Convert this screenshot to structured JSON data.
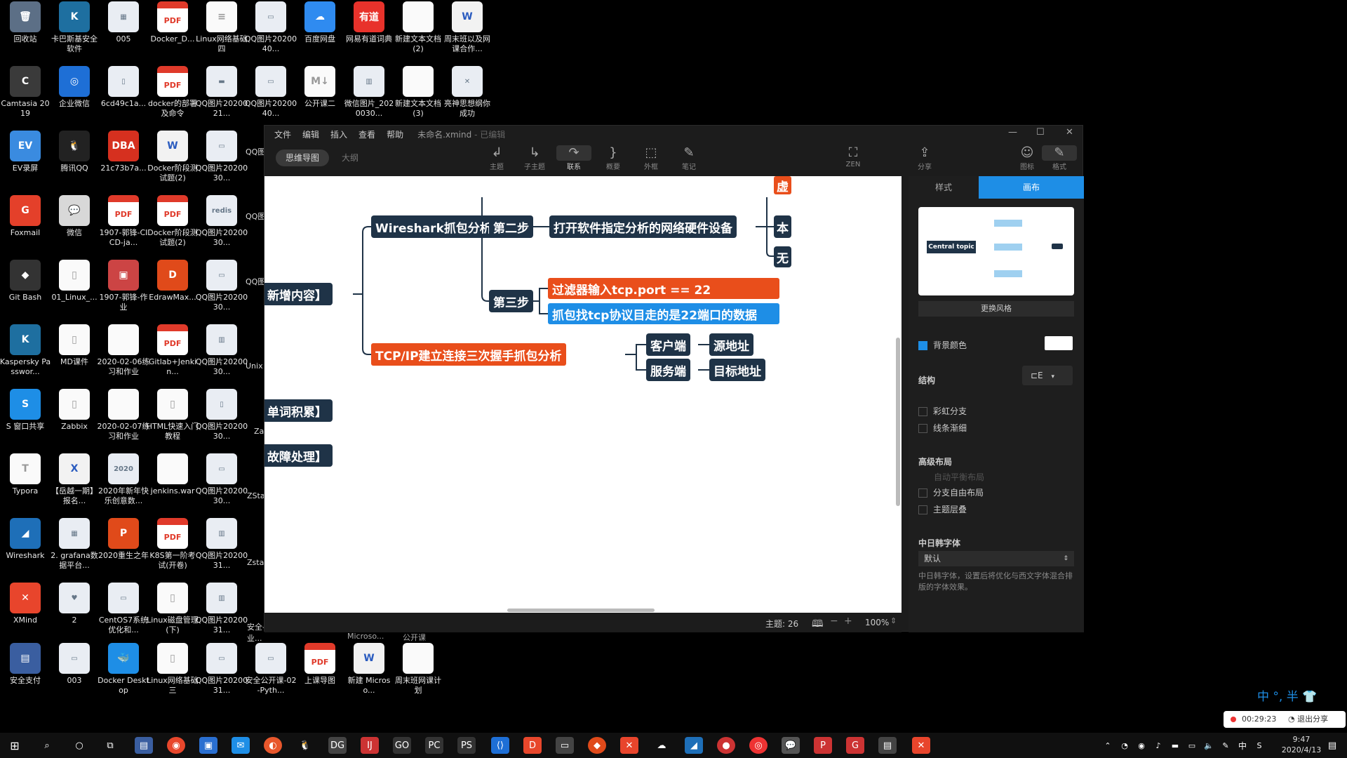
{
  "desktop": {
    "icons": [
      {
        "label": "回收站",
        "glyph": "🗑",
        "kind": "app",
        "color": "#5c6f86"
      },
      {
        "label": "卡巴斯基安全软件",
        "glyph": "K",
        "kind": "app",
        "color": "#1e6fa0"
      },
      {
        "label": "005",
        "glyph": "▦",
        "kind": "img",
        "color": ""
      },
      {
        "label": "Docker_D...",
        "glyph": "PDF",
        "kind": "pdf",
        "color": ""
      },
      {
        "label": "Linux网络基础四",
        "glyph": "≡",
        "kind": "txt",
        "color": ""
      },
      {
        "label": "QQ图片2020040...",
        "glyph": "▭",
        "kind": "img",
        "color": ""
      },
      {
        "label": "百度网盘",
        "glyph": "☁",
        "kind": "app",
        "color": "#2f8bf0"
      },
      {
        "label": "网易有道词典",
        "glyph": "有道",
        "kind": "app",
        "color": "#e8322b"
      },
      {
        "label": "新建文本文档 (2)",
        "glyph": "",
        "kind": "txt",
        "color": ""
      },
      {
        "label": "周末班以及网课合作...",
        "glyph": "W",
        "kind": "doc",
        "color": ""
      },
      {
        "label": "Camtasia 2019",
        "glyph": "C",
        "kind": "app",
        "color": "#3a3a3a"
      },
      {
        "label": "企业微信",
        "glyph": "◎",
        "kind": "app",
        "color": "#1e6fd6"
      },
      {
        "label": "6cd49c1a...",
        "glyph": "▯",
        "kind": "img",
        "color": ""
      },
      {
        "label": "docker的部署及命令",
        "glyph": "PDF",
        "kind": "pdf",
        "color": ""
      },
      {
        "label": "QQ图片2020021...",
        "glyph": "▬",
        "kind": "img",
        "color": ""
      },
      {
        "label": "QQ图片2020040...",
        "glyph": "▭",
        "kind": "img",
        "color": ""
      },
      {
        "label": "公开课二",
        "glyph": "M↓",
        "kind": "txt",
        "color": ""
      },
      {
        "label": "微信图片_2020030...",
        "glyph": "▥",
        "kind": "img",
        "color": ""
      },
      {
        "label": "新建文本文档 (3)",
        "glyph": "",
        "kind": "txt",
        "color": ""
      },
      {
        "label": "亮神思想纲你成功",
        "glyph": "✕",
        "kind": "img",
        "color": ""
      },
      {
        "label": "EV录屏",
        "glyph": "EV",
        "kind": "app",
        "color": "#3a8be0"
      },
      {
        "label": "腾讯QQ",
        "glyph": "🐧",
        "kind": "app",
        "color": "#222"
      },
      {
        "label": "21c73b7a...",
        "glyph": "DBA",
        "kind": "app",
        "color": "#d6301f"
      },
      {
        "label": "Docker阶段测试题(2)",
        "glyph": "W",
        "kind": "doc",
        "color": ""
      },
      {
        "label": "QQ图片2020030...",
        "glyph": "▭",
        "kind": "img",
        "color": ""
      },
      {
        "label": "Foxmail",
        "glyph": "G",
        "kind": "app",
        "color": "#e4402a"
      },
      {
        "label": "微信",
        "glyph": "💬",
        "kind": "app",
        "color": "#d8d8d8"
      },
      {
        "label": "1907-郭锋-CICD-ja...",
        "glyph": "PDF",
        "kind": "pdf",
        "color": ""
      },
      {
        "label": "Docker阶段测试题(2)",
        "glyph": "PDF",
        "kind": "pdf",
        "color": ""
      },
      {
        "label": "QQ图片2020030...",
        "glyph": "redis",
        "kind": "img",
        "color": ""
      },
      {
        "label": "Git Bash",
        "glyph": "◆",
        "kind": "app",
        "color": "#333"
      },
      {
        "label": "01_Linux_...",
        "glyph": "▯",
        "kind": "txt",
        "color": ""
      },
      {
        "label": "1907-郭锋-作业",
        "glyph": "▣",
        "kind": "app",
        "color": "#c44"
      },
      {
        "label": "EdrawMax...",
        "glyph": "D",
        "kind": "app",
        "color": "#e04a1a"
      },
      {
        "label": "QQ图片2020030...",
        "glyph": "▭",
        "kind": "img",
        "color": ""
      },
      {
        "label": "Kaspersky Passwor...",
        "glyph": "K",
        "kind": "app",
        "color": "#1e6fa0"
      },
      {
        "label": "MD课件",
        "glyph": "▯",
        "kind": "txt",
        "color": ""
      },
      {
        "label": "2020-02-06练习和作业",
        "glyph": "",
        "kind": "txt",
        "color": ""
      },
      {
        "label": "Gitlab+Jenkin...",
        "glyph": "PDF",
        "kind": "pdf",
        "color": ""
      },
      {
        "label": "QQ图片2020030...",
        "glyph": "▥",
        "kind": "img",
        "color": ""
      },
      {
        "label": "S 窗口共享",
        "glyph": "S",
        "kind": "app",
        "color": "#1e8ee6"
      },
      {
        "label": "Zabbix",
        "glyph": "▯",
        "kind": "txt",
        "color": ""
      },
      {
        "label": "2020-02-07练习和作业",
        "glyph": "",
        "kind": "txt",
        "color": ""
      },
      {
        "label": "HTML快速入门教程",
        "glyph": "▯",
        "kind": "txt",
        "color": ""
      },
      {
        "label": "QQ图片2020030...",
        "glyph": "▯",
        "kind": "img",
        "color": ""
      },
      {
        "label": "Typora",
        "glyph": "T",
        "kind": "txt",
        "color": ""
      },
      {
        "label": "【岳越一期】报名...",
        "glyph": "X",
        "kind": "doc",
        "color": ""
      },
      {
        "label": "2020年新年快乐创意数...",
        "glyph": "2020",
        "kind": "img",
        "color": ""
      },
      {
        "label": "jenkins.war",
        "glyph": "",
        "kind": "txt",
        "color": ""
      },
      {
        "label": "QQ图片2020030...",
        "glyph": "▭",
        "kind": "img",
        "color": ""
      },
      {
        "label": "Wireshark",
        "glyph": "◢",
        "kind": "app",
        "color": "#1e6fb8"
      },
      {
        "label": "2. grafana数据平台...",
        "glyph": "▦",
        "kind": "img",
        "color": ""
      },
      {
        "label": "2020重生之年",
        "glyph": "P",
        "kind": "app",
        "color": "#e04a1a"
      },
      {
        "label": "K8S第一阶考试(开卷)",
        "glyph": "PDF",
        "kind": "pdf",
        "color": ""
      },
      {
        "label": "QQ图片2020031...",
        "glyph": "▥",
        "kind": "img",
        "color": ""
      },
      {
        "label": "XMind",
        "glyph": "✕",
        "kind": "app",
        "color": "#e8452c"
      },
      {
        "label": "2",
        "glyph": "♥",
        "kind": "img",
        "color": ""
      },
      {
        "label": "CentOS7系统优化和...",
        "glyph": "▭",
        "kind": "img",
        "color": ""
      },
      {
        "label": "Linux磁盘管理(下)",
        "glyph": "▯",
        "kind": "txt",
        "color": ""
      },
      {
        "label": "QQ图片2020031...",
        "glyph": "▥",
        "kind": "img",
        "color": ""
      },
      {
        "label": "安全支付",
        "glyph": "▤",
        "kind": "app",
        "color": "#3a5ea0"
      },
      {
        "label": "003",
        "glyph": "▭",
        "kind": "img",
        "color": ""
      },
      {
        "label": "Docker Desktop",
        "glyph": "🐳",
        "kind": "app",
        "color": "#1e8ee6"
      },
      {
        "label": "Linux网络基础三",
        "glyph": "▯",
        "kind": "txt",
        "color": ""
      },
      {
        "label": "QQ图片2020031...",
        "glyph": "▭",
        "kind": "img",
        "color": ""
      },
      {
        "label": "安全公开课-02-Pyth...",
        "glyph": "▭",
        "kind": "img",
        "color": ""
      },
      {
        "label": "上课导图",
        "glyph": "PDF",
        "kind": "pdf",
        "color": ""
      },
      {
        "label": "新建 Microso...",
        "glyph": "W",
        "kind": "doc",
        "color": ""
      },
      {
        "label": "周末班网课计划",
        "glyph": "",
        "kind": "txt",
        "color": ""
      }
    ],
    "partial_labels": {
      "col6_row2": "QQ图片202",
      "col6_row3": "QQ图片202",
      "col6_row4": "QQ图片202",
      "col6_row5": "Unix",
      "col6_row6": "Za",
      "col6_row7": "ZSta",
      "col6_row8": "Zsta试",
      "col6_row9": "安全-01-行业...",
      "under_win_1": "Microso...",
      "under_win_2": "公开课"
    }
  },
  "app": {
    "menu": [
      "文件",
      "编辑",
      "插入",
      "查看",
      "帮助"
    ],
    "title": "未命名.xmind",
    "title_suffix": "- 已编辑",
    "view_tabs": {
      "active": "思维导图",
      "inactive": "大纲"
    },
    "toolbar": [
      {
        "label": "主题",
        "glyph": "↲"
      },
      {
        "label": "子主题",
        "glyph": "↳"
      },
      {
        "label": "联系",
        "glyph": "↷"
      },
      {
        "label": "概要",
        "glyph": "}"
      },
      {
        "label": "外框",
        "glyph": "⬚"
      },
      {
        "label": "笔记",
        "glyph": "✎"
      },
      {
        "label": "ZEN",
        "glyph": "⛶"
      },
      {
        "label": "分享",
        "glyph": "⇪"
      },
      {
        "label": "图标",
        "glyph": "☺"
      },
      {
        "label": "格式",
        "glyph": "✎"
      }
    ],
    "window_controls": [
      "—",
      "☐",
      "✕"
    ]
  },
  "mindmap": {
    "left_nodes": [
      "新增内容】",
      "单词积累】",
      "故障处理】"
    ],
    "wireshark": "Wireshark抓包分析",
    "step2": "第二步",
    "step2_detail": "打开软件指定分析的网络硬件设备",
    "step3": "第三步",
    "step3_filter": "过滤器输入tcp.port == 22",
    "step3_capture": "抓包找tcp协议目走的是22端口的数据",
    "tcpip": "TCP/IP建立连接三次握手抓包分析",
    "client": "客户端",
    "server": "服务端",
    "src_addr": "源地址",
    "dst_addr": "目标地址",
    "edge_top": "虚",
    "edge_mid": "本",
    "edge_bot": "无"
  },
  "status": {
    "topic_count": "主题: 26",
    "zoom": "100%"
  },
  "panel": {
    "tabs": {
      "style": "样式",
      "canvas": "画布"
    },
    "preview_center": "Central topic",
    "change_style": "更换风格",
    "bg_color": "背景颜色",
    "structure": "结构",
    "rainbow": "彩虹分支",
    "taper": "线条渐细",
    "advanced_layout": "高级布局",
    "auto_balance": "自动平衡布局",
    "free_branch": "分支自由布局",
    "topic_level": "主题层叠",
    "cjk_font": "中日韩字体",
    "font_value": "默认",
    "font_desc": "中日韩字体，设置后将优化与西文字体混合排版的字体效果。"
  },
  "recording": {
    "time": "00:29:23",
    "exit_share": "退出分享"
  },
  "ime": "中 °, 半 👕",
  "clock": {
    "time": "9:47",
    "date": "2020/4/13"
  },
  "tray_lang": "中",
  "colors": {
    "dark_node": "#1f3347",
    "orange": "#e94e1b",
    "blue": "#1e8ee6"
  }
}
